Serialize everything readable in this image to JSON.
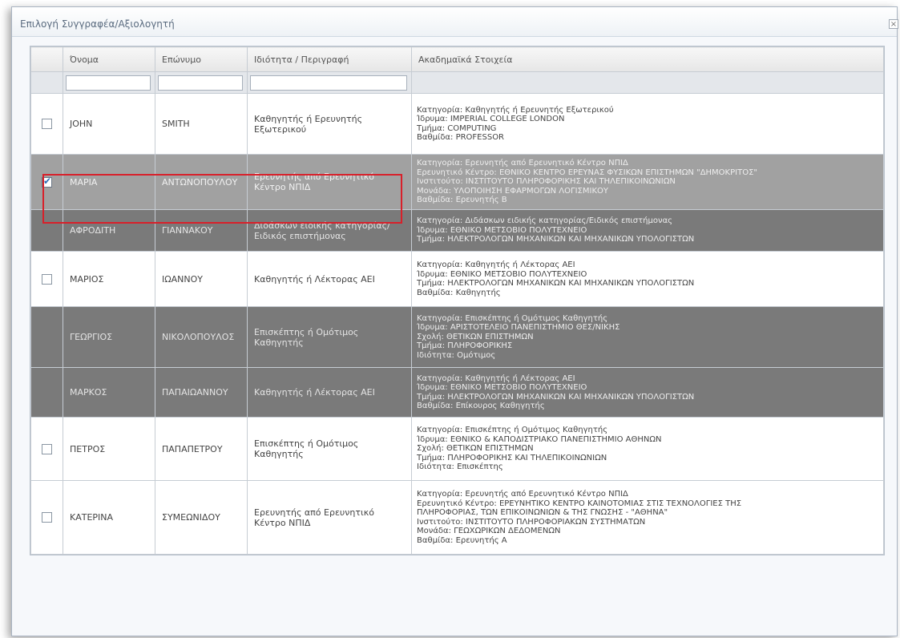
{
  "dialog": {
    "title": "Επιλογή Συγγραφέα/Αξιολογητή",
    "close_label": "×"
  },
  "table": {
    "columns": [
      "",
      "Όνομα",
      "Επώνυμο",
      "Ιδιότητα / Περιγραφή",
      "Ακαδημαϊκά Στοιχεία"
    ],
    "rows": [
      {
        "checked": false,
        "state": "white",
        "first_name": "JOHN",
        "last_name": "SMITH",
        "role": "Καθηγητής ή Ερευνητής Εξωτερικού",
        "details": [
          "Κατηγορία: Καθηγητής ή Ερευνητής Εξωτερικού",
          "Ίδρυμα: IMPERIAL COLLEGE LONDON",
          "Τμήμα: COMPUTING",
          "Βαθμίδα: PROFESSOR"
        ]
      },
      {
        "checked": true,
        "state": "selected",
        "first_name": "ΜΑΡΙΑ",
        "last_name": "ΑΝΤΩΝΟΠΟΥΛΟΥ",
        "role": "Ερευνητής από Ερευνητικό Κέντρο ΝΠΙΔ",
        "details": [
          "Κατηγορία: Ερευνητής από Ερευνητικό Κέντρο ΝΠΙΔ",
          "Ερευνητικό Κέντρο: ΕΘΝΙΚΟ ΚΕΝΤΡΟ ΕΡΕΥΝΑΣ ΦΥΣΙΚΩΝ ΕΠΙΣΤΗΜΩΝ \"ΔΗΜΟΚΡΙΤΟΣ\"",
          "Ινστιτούτο: ΙΝΣΤΙΤΟΥΤΟ ΠΛΗΡΟΦΟΡΙΚΗΣ ΚΑΙ ΤΗΛΕΠΙΚΟΙΝΩΝΙΩΝ",
          "Μονάδα: ΥΛΟΠΟΙΗΣΗ ΕΦΑΡΜΟΓΩΝ ΛΟΓΙΣΜΙΚΟΥ",
          "Βαθμίδα: Ερευνητής Β"
        ]
      },
      {
        "checked": false,
        "state": "dark",
        "hide_checkbox": true,
        "first_name": "ΑΦΡΟΔΙΤΗ",
        "last_name": "ΓΙΑΝΝΑΚΟΥ",
        "role": "Διδάσκων ειδικής κατηγορίας/ Ειδικός επιστήμονας",
        "details": [
          "Κατηγορία: Διδάσκων ειδικής κατηγορίας/Ειδικός επιστήμονας",
          "Ίδρυμα: ΕΘΝΙΚΟ ΜΕΤΣΟΒΙΟ ΠΟΛΥΤΕΧΝΕΙΟ",
          "Τμήμα: ΗΛΕΚΤΡΟΛΟΓΩΝ ΜΗΧΑΝΙΚΩΝ ΚΑΙ ΜΗΧΑΝΙΚΩΝ ΥΠΟΛΟΓΙΣΤΩΝ"
        ]
      },
      {
        "checked": false,
        "state": "white",
        "first_name": "ΜΑΡΙΟΣ",
        "last_name": "ΙΩΑΝΝΟΥ",
        "role": "Καθηγητής ή Λέκτορας ΑΕΙ",
        "details": [
          "Κατηγορία: Καθηγητής ή Λέκτορας ΑΕΙ",
          "Ίδρυμα: ΕΘΝΙΚΟ ΜΕΤΣΟΒΙΟ ΠΟΛΥΤΕΧΝΕΙΟ",
          "Τμήμα: ΗΛΕΚΤΡΟΛΟΓΩΝ ΜΗΧΑΝΙΚΩΝ ΚΑΙ ΜΗΧΑΝΙΚΩΝ ΥΠΟΛΟΓΙΣΤΩΝ",
          "Βαθμίδα: Καθηγητής"
        ]
      },
      {
        "checked": false,
        "state": "dark",
        "hide_checkbox": true,
        "first_name": "ΓΕΩΡΓΙΟΣ",
        "last_name": "ΝΙΚΟΛΟΠΟΥΛΟΣ",
        "role": "Επισκέπτης ή Ομότιμος Καθηγητής",
        "details": [
          "Κατηγορία: Επισκέπτης ή Ομότιμος Καθηγητής",
          "Ίδρυμα: ΑΡΙΣΤΟΤΕΛΕΙΟ ΠΑΝΕΠΙΣΤΗΜΙΟ ΘΕΣ/ΝΙΚΗΣ",
          "Σχολή: ΘΕΤΙΚΩΝ ΕΠΙΣΤΗΜΩΝ",
          "Τμήμα: ΠΛΗΡΟΦΟΡΙΚΗΣ",
          "Ιδιότητα: Ομότιμος"
        ]
      },
      {
        "checked": false,
        "state": "dark",
        "hide_checkbox": true,
        "first_name": "ΜΑΡΚΟΣ",
        "last_name": "ΠΑΠΑΙΩΑΝΝΟΥ",
        "role": "Καθηγητής ή Λέκτορας ΑΕΙ",
        "details": [
          "Κατηγορία: Καθηγητής ή Λέκτορας ΑΕΙ",
          "Ίδρυμα: ΕΘΝΙΚΟ ΜΕΤΣΟΒΙΟ ΠΟΛΥΤΕΧΝΕΙΟ",
          "Τμήμα: ΗΛΕΚΤΡΟΛΟΓΩΝ ΜΗΧΑΝΙΚΩΝ ΚΑΙ ΜΗΧΑΝΙΚΩΝ ΥΠΟΛΟΓΙΣΤΩΝ",
          "Βαθμίδα: Επίκουρος Καθηγητής"
        ]
      },
      {
        "checked": false,
        "state": "white",
        "first_name": "ΠΕΤΡΟΣ",
        "last_name": "ΠΑΠΑΠΕΤΡΟΥ",
        "role": "Επισκέπτης ή Ομότιμος Καθηγητής",
        "details": [
          "Κατηγορία: Επισκέπτης ή Ομότιμος Καθηγητής",
          "Ίδρυμα: ΕΘΝΙΚΟ & ΚΑΠΟΔΙΣΤΡΙΑΚΟ ΠΑΝΕΠΙΣΤΗΜΙΟ ΑΘΗΝΩΝ",
          "Σχολή: ΘΕΤΙΚΩΝ ΕΠΙΣΤΗΜΩΝ",
          "Τμήμα: ΠΛΗΡΟΦΟΡΙΚΗΣ ΚΑΙ ΤΗΛΕΠΙΚΟΙΝΩΝΙΩΝ",
          "Ιδιότητα: Επισκέπτης"
        ]
      },
      {
        "checked": false,
        "state": "white",
        "first_name": "ΚΑΤΕΡΙΝΑ",
        "last_name": "ΣΥΜΕΩΝΙΔΟΥ",
        "role": "Ερευνητής από Ερευνητικό Κέντρο ΝΠΙΔ",
        "details": [
          "Κατηγορία: Ερευνητής από Ερευνητικό Κέντρο ΝΠΙΔ",
          "Ερευνητικό Κέντρο: ΕΡΕΥΝΗΤΙΚΟ ΚΕΝΤΡΟ ΚΑΙΝΟΤΟΜΙΑΣ ΣΤΙΣ ΤΕΧΝΟΛΟΓΙΕΣ ΤΗΣ",
          "ΠΛΗΡΟΦΟΡΙΑΣ, ΤΩΝ ΕΠΙΚΟΙΝΩΝΙΩΝ & ΤΗΣ ΓΝΩΣΗΣ - \"ΑΘΗΝΑ\"",
          "Ινστιτούτο: ΙΝΣΤΙΤΟΥΤΟ ΠΛΗΡΟΦΟΡΙΑΚΩΝ ΣΥΣΤΗΜΑΤΩΝ",
          "Μονάδα: ΓΕΩΧΩΡΙΚΩΝ ΔΕΔΟΜΕΝΩΝ",
          "Βαθμίδα: Ερευνητής Α"
        ]
      }
    ]
  },
  "colors": {
    "row_selected": "#a1a1a1",
    "row_dark": "#7a7a7a",
    "highlight": "#d8202a"
  }
}
